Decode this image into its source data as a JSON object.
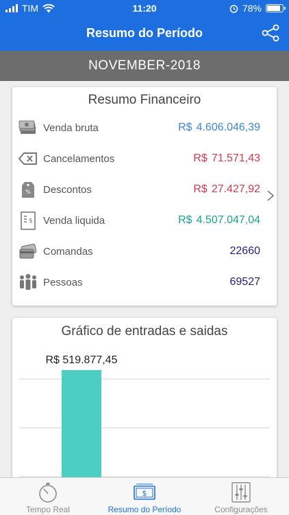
{
  "status_bar": {
    "carrier": "TIM",
    "time": "11:20",
    "battery": "78%"
  },
  "header": {
    "title": "Resumo do Período"
  },
  "period": {
    "label": "NOVEMBER-2018"
  },
  "summary": {
    "title": "Resumo Financeiro",
    "rows": [
      {
        "label": "Venda bruta",
        "currency": "R$",
        "value": "4.606.046,39",
        "color": "#3b86d6",
        "icon": "money-stack-icon"
      },
      {
        "label": "Cancelamentos",
        "currency": "R$",
        "value": "71.571,43",
        "color": "#d6394a",
        "icon": "backspace-x-icon"
      },
      {
        "label": "Descontos",
        "currency": "R$",
        "value": "27.427,92",
        "color": "#d6394a",
        "icon": "price-tag-icon"
      },
      {
        "label": "Venda liquida",
        "currency": "R$",
        "value": "4.507.047,04",
        "color": "#17a592",
        "icon": "receipt-icon"
      },
      {
        "label": "Comandas",
        "currency": "",
        "value": "22660",
        "color": "#2b1a78",
        "icon": "cards-icon"
      },
      {
        "label": "Pessoas",
        "currency": "",
        "value": "69527",
        "color": "#2b1a78",
        "icon": "people-icon"
      }
    ]
  },
  "chart": {
    "title": "Gráfico de entradas e saidas",
    "bar_label": "R$ 519.877,45",
    "bar_color": "#4dcec2"
  },
  "chart_data": {
    "type": "bar",
    "categories": [
      ""
    ],
    "values": [
      519877.45
    ],
    "title": "Gráfico de entradas e saidas",
    "data_labels": [
      "R$ 519.877,45"
    ]
  },
  "tabs": [
    {
      "label": "Tempo Real",
      "icon": "stopwatch-icon",
      "active": false
    },
    {
      "label": "Resumo do Período",
      "icon": "cash-bill-icon",
      "active": true
    },
    {
      "label": "Configurações",
      "icon": "sliders-icon",
      "active": false
    }
  ],
  "colors": {
    "header": "#1d6fe0",
    "period_bar": "#6d6d6d"
  }
}
